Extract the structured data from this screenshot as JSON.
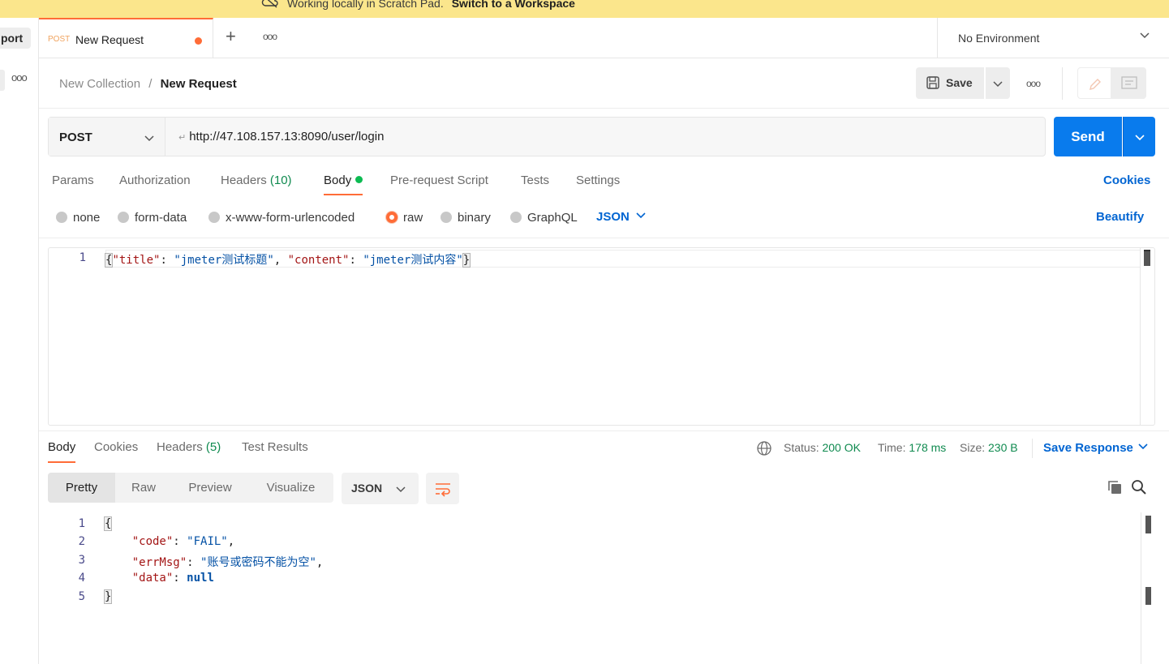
{
  "banner": {
    "text": "Working locally in Scratch Pad.",
    "link": "Switch to a Workspace"
  },
  "sidebar": {
    "import_label": "port"
  },
  "tabs": [
    {
      "method": "POST",
      "name": "New Request",
      "unsaved": true
    }
  ],
  "environment": {
    "label": "No Environment"
  },
  "breadcrumb": {
    "collection": "New Collection",
    "separator": "/",
    "request": "New Request"
  },
  "header": {
    "save_label": "Save"
  },
  "request": {
    "method": "POST",
    "url": "http://47.108.157.13:8090/user/login",
    "send_label": "Send"
  },
  "request_tabs": {
    "params": "Params",
    "authorization": "Authorization",
    "headers": "Headers",
    "headers_count": "(10)",
    "body": "Body",
    "pre_request": "Pre-request Script",
    "tests": "Tests",
    "settings": "Settings",
    "cookies": "Cookies"
  },
  "body_types": {
    "none": "none",
    "form_data": "form-data",
    "urlencoded": "x-www-form-urlencoded",
    "raw": "raw",
    "binary": "binary",
    "graphql": "GraphQL",
    "selected": "raw",
    "language": "JSON",
    "beautify": "Beautify"
  },
  "request_body": {
    "line_numbers": [
      "1"
    ],
    "k_title": "\"title\"",
    "v_title": "\"jmeter测试标题\"",
    "k_content": "\"content\"",
    "v_content": "\"jmeter测试内容\""
  },
  "response_tabs": {
    "body": "Body",
    "cookies": "Cookies",
    "headers": "Headers",
    "headers_count": "(5)",
    "test_results": "Test Results"
  },
  "response_meta": {
    "status_label": "Status:",
    "status_value": "200 OK",
    "time_label": "Time:",
    "time_value": "178 ms",
    "size_label": "Size:",
    "size_value": "230 B",
    "save_response": "Save Response"
  },
  "response_view": {
    "pretty": "Pretty",
    "raw": "Raw",
    "preview": "Preview",
    "visualize": "Visualize",
    "format": "JSON"
  },
  "response_body": {
    "line_numbers": [
      "1",
      "2",
      "3",
      "4",
      "5"
    ],
    "k_code": "\"code\"",
    "v_code": "\"FAIL\"",
    "k_errmsg": "\"errMsg\"",
    "v_errmsg": "\"账号或密码不能为空\"",
    "k_data": "\"data\"",
    "v_data": "null"
  },
  "colors": {
    "accent": "#ff6c37",
    "primary": "#097bed",
    "link": "#0265d2",
    "success": "#0f8a4f",
    "banner": "#fbe68c"
  }
}
